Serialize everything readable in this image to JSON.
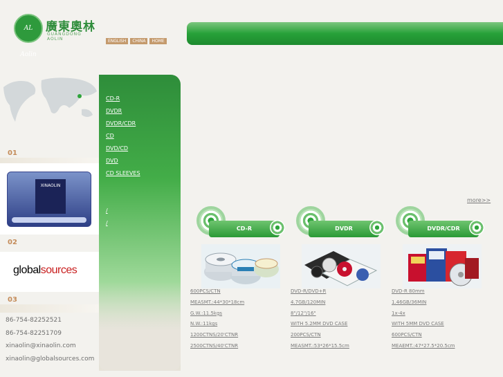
{
  "header": {
    "logo_mark": "AL Aolin",
    "logo_cn": "廣東奧林",
    "logo_en": "GUANGDONG AOLIN",
    "languages": [
      "ENGLISH",
      "CHINA",
      "HOME"
    ]
  },
  "sidebar": {
    "sections": [
      "01",
      "02",
      "03"
    ],
    "screenshot_label": "XINAOLIN",
    "global_sources": {
      "part1": "global",
      "part2": "sources"
    },
    "contact": [
      "86-754-82252521",
      "86-754-82251709",
      "xinaolin@xinaolin.com",
      "xinaolin@globalsources.com"
    ]
  },
  "nav": {
    "items": [
      "CD-R",
      "DVDR",
      "DVDR/CDR",
      "CD",
      "DVD/CD",
      "DVD",
      "CD SLEEVES",
      "",
      "",
      "/",
      "/",
      ""
    ]
  },
  "main": {
    "intro_prefix": "",
    "intro_brand": "",
    "intro_text": "",
    "more_label": "more>>",
    "products": [
      {
        "name": "CD-R",
        "specs": [
          "600PCS/CTN",
          "MEASMT.:44*30*18cm",
          "G.W.:11.5kgs",
          "N.W.:11kgs",
          "1200CTNS/20'CTNR",
          "2500CTNS/40'CTNR"
        ]
      },
      {
        "name": "DVDR",
        "specs": [
          "DVD-R/DVD+R",
          "4.7GB/120MIN",
          "8\"/12\"/16\"",
          "WITH 5.2MM DVD CASE",
          "200PCS/CTN",
          "MEASMT.:53*26*15.5cm"
        ]
      },
      {
        "name": "DVDR/CDR",
        "specs": [
          "DVD-R 80mm",
          "1.46GB/36MIN",
          "1x-4x",
          "WITH 5MM DVD CASE",
          "600PCS/CTN",
          "MEAEMT.:47*27.5*20.5cm"
        ]
      }
    ]
  },
  "colors": {
    "green": "#2a9a36",
    "accent_tan": "#c49a6c"
  }
}
